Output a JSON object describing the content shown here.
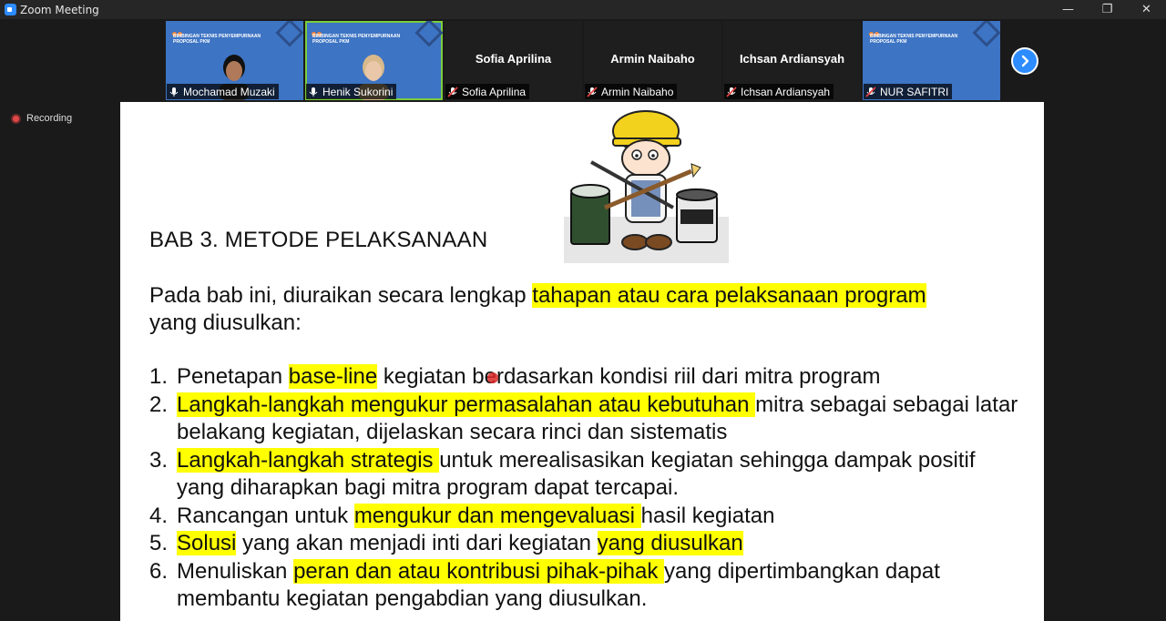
{
  "window": {
    "title": "Zoom Meeting",
    "controls": {
      "minimize": "—",
      "restore": "❐",
      "close": "✕"
    }
  },
  "gallery": {
    "participants": [
      {
        "name": "Mochamad Muzaki",
        "type": "slide-video",
        "mic": "unmuted",
        "mini_title": "BIMBINGAN TEKNIS PENYEMPURNAAN PROPOSAL PKM"
      },
      {
        "name": "Henik Sukorini",
        "type": "slide-video",
        "mic": "unmuted",
        "active": true,
        "mini_title": "BIMBINGAN TEKNIS PENYEMPURNAAN PROPOSAL PKM"
      },
      {
        "name": "Sofia Aprilina",
        "type": "name-only",
        "mic": "muted"
      },
      {
        "name": "Armin Naibaho",
        "type": "name-only",
        "mic": "muted"
      },
      {
        "name": "Ichsan Ardiansyah",
        "type": "name-only",
        "mic": "muted"
      },
      {
        "name": "NUR SAFITRI",
        "type": "slide",
        "mic": "muted",
        "mini_title": "BIMBINGAN TEKNIS PENYEMPURNAAN PROPOSAL PKM"
      }
    ],
    "next_icon": "chevron-right-icon"
  },
  "recording": {
    "label": "Recording"
  },
  "slide": {
    "heading": "BAB 3. METODE PELAKSANAAN",
    "intro_plain": "Pada bab ini, diuraikan secara lengkap ",
    "intro_hl": "tahapan atau cara pelaksanaan program ",
    "intro_tail": "yang diusulkan:",
    "items": [
      {
        "num": "1.",
        "parts": [
          {
            "t": "Penetapan "
          },
          {
            "t": "base-line",
            "hl": true
          },
          {
            "t": " kegiatan berdasarkan kondisi riil dari mitra program"
          }
        ]
      },
      {
        "num": "2.",
        "parts": [
          {
            "t": "Langkah-langkah mengukur permasalahan atau kebutuhan ",
            "hl": true
          },
          {
            "t": "mitra sebagai sebagai latar belakang kegiatan, dijelaskan secara rinci dan sistematis"
          }
        ]
      },
      {
        "num": "3.",
        "parts": [
          {
            "t": "Langkah-langkah strategis ",
            "hl": true
          },
          {
            "t": "untuk merealisasikan kegiatan sehingga dampak positif yang diharapkan bagi mitra program dapat tercapai."
          }
        ]
      },
      {
        "num": "4.",
        "parts": [
          {
            "t": "Rancangan untuk "
          },
          {
            "t": "mengukur dan mengevaluasi ",
            "hl": true
          },
          {
            "t": "hasil kegiatan"
          }
        ]
      },
      {
        "num": "5.",
        "parts": [
          {
            "t": "Solusi",
            "hl": true
          },
          {
            "t": " yang akan menjadi inti dari kegiatan "
          },
          {
            "t": "yang diusulkan",
            "hl": true
          }
        ]
      },
      {
        "num": "6.",
        "parts": [
          {
            "t": "Menuliskan "
          },
          {
            "t": "peran dan atau kontribusi pihak-pihak ",
            "hl": true
          },
          {
            "t": "yang dipertimbangkan dapat membantu kegiatan pengabdian yang diusulkan."
          }
        ]
      }
    ],
    "highlight_color": "#ffff00"
  }
}
